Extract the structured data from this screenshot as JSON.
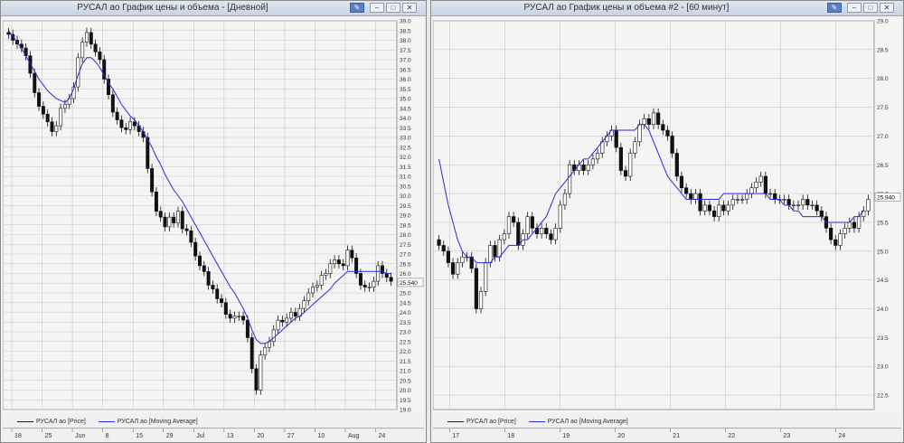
{
  "windows": [
    {
      "title": "РУСАЛ ао График цены и объема - [Дневной]",
      "legend": [
        "РУСАЛ ао [Price]",
        "РУСАЛ ао [Moving Average]"
      ],
      "last_price_label": "25.540",
      "x_labels": [
        "18",
        "25",
        "Jun",
        "8",
        "15",
        "29",
        "Jul",
        "13",
        "20",
        "27",
        "10",
        "Aug",
        "24"
      ],
      "chart_data": {
        "type": "candlestick",
        "ylim": [
          19.0,
          39.0
        ],
        "y_ticks": [
          "39.0",
          "38.5",
          "38.0",
          "37.5",
          "37.0",
          "36.5",
          "36.0",
          "35.5",
          "35.0",
          "34.5",
          "34.0",
          "33.5",
          "33.0",
          "32.5",
          "32.0",
          "31.5",
          "31.0",
          "30.5",
          "30.0",
          "29.5",
          "29.0",
          "28.5",
          "28.0",
          "27.5",
          "27.0",
          "26.5",
          "26.0",
          "25.5",
          "25.0",
          "24.5",
          "24.0",
          "23.5",
          "23.0",
          "22.5",
          "22.0",
          "21.5",
          "21.0",
          "20.5",
          "20.0",
          "19.5",
          "19.0"
        ],
        "close": [
          38.3,
          38.0,
          37.8,
          37.6,
          37.2,
          36.3,
          35.3,
          34.6,
          34.2,
          33.8,
          33.3,
          33.6,
          34.5,
          34.7,
          35.0,
          35.6,
          37.1,
          37.9,
          38.4,
          37.8,
          37.4,
          37.0,
          36.0,
          35.2,
          34.3,
          33.9,
          33.5,
          33.4,
          33.8,
          33.6,
          33.3,
          33.0,
          31.4,
          30.2,
          29.2,
          28.9,
          28.4,
          28.9,
          28.6,
          29.2,
          28.3,
          28.2,
          27.6,
          26.9,
          26.4,
          26.1,
          25.4,
          25.2,
          24.7,
          24.5,
          23.9,
          23.7,
          23.8,
          23.8,
          23.6,
          22.7,
          21.1,
          20.0,
          21.8,
          22.2,
          22.5,
          23.1,
          23.6,
          23.5,
          23.7,
          24.0,
          23.8,
          24.2,
          24.6,
          25.0,
          25.3,
          25.4,
          25.9,
          26.0,
          26.5,
          26.7,
          26.5,
          26.4,
          27.2,
          26.8,
          26.0,
          25.4,
          25.3,
          25.3,
          25.6,
          26.4,
          26.0,
          25.8,
          25.6
        ],
        "ma": [
          38.5,
          38.2,
          37.9,
          37.6,
          37.2,
          36.8,
          36.4,
          36.0,
          35.7,
          35.4,
          35.2,
          35.0,
          34.9,
          34.8,
          35.0,
          35.5,
          36.2,
          36.8,
          37.1,
          37.1,
          36.9,
          36.6,
          36.2,
          35.8,
          35.5,
          35.1,
          34.7,
          34.4,
          34.1,
          33.9,
          33.6,
          33.3,
          32.9,
          32.5,
          32.0,
          31.6,
          31.1,
          30.7,
          30.3,
          30.0,
          29.7,
          29.3,
          28.9,
          28.5,
          28.1,
          27.7,
          27.3,
          26.9,
          26.5,
          26.1,
          25.7,
          25.3,
          25.0,
          24.6,
          24.2,
          23.7,
          23.1,
          22.6,
          22.4,
          22.4,
          22.5,
          22.7,
          22.9,
          23.1,
          23.3,
          23.5,
          23.7,
          23.8,
          24.0,
          24.2,
          24.4,
          24.6,
          24.8,
          25.0,
          25.2,
          25.5,
          25.7,
          25.9,
          26.1,
          26.1,
          26.1,
          26.1,
          26.1,
          26.1,
          26.1,
          26.1,
          26.1,
          26.0,
          26.0
        ]
      }
    },
    {
      "title": "РУСАЛ ао График цены и объема #2 - [60 минут]",
      "legend": [
        "РУСАЛ ао [Price]",
        "РУСАЛ ао [Moving Average]"
      ],
      "last_price_label": "25.940",
      "x_labels": [
        "17",
        "18",
        "19",
        "20",
        "21",
        "22",
        "23",
        "24"
      ],
      "chart_data": {
        "type": "candlestick",
        "ylim": [
          22.25,
          29.0
        ],
        "y_ticks": [
          "29.0",
          "28.5",
          "28.0",
          "27.5",
          "27.0",
          "26.5",
          "26.0",
          "25.5",
          "25.0",
          "24.5",
          "24.0",
          "23.5",
          "23.0",
          "22.5"
        ],
        "close": [
          25.1,
          25.0,
          24.8,
          24.6,
          24.8,
          24.9,
          24.9,
          24.7,
          24.0,
          24.3,
          24.8,
          25.1,
          24.9,
          25.2,
          25.3,
          25.6,
          25.5,
          25.1,
          25.3,
          25.6,
          25.4,
          25.3,
          25.4,
          25.3,
          25.2,
          25.4,
          25.8,
          26.0,
          26.5,
          26.4,
          26.5,
          26.4,
          26.5,
          26.6,
          26.7,
          26.9,
          27.0,
          27.1,
          26.8,
          26.4,
          26.3,
          26.7,
          26.9,
          27.2,
          27.3,
          27.2,
          27.4,
          27.2,
          27.1,
          27.0,
          26.7,
          26.3,
          26.1,
          26.0,
          25.9,
          26.0,
          25.7,
          25.8,
          25.7,
          25.6,
          25.8,
          25.7,
          25.8,
          25.9,
          25.9,
          25.9,
          26.0,
          26.1,
          26.2,
          26.3,
          26.0,
          26.0,
          25.9,
          25.9,
          25.9,
          25.8,
          25.8,
          25.8,
          25.9,
          25.8,
          25.8,
          25.7,
          25.6,
          25.4,
          25.2,
          25.1,
          25.3,
          25.4,
          25.5,
          25.4,
          25.6,
          25.7,
          25.9
        ],
        "ma": [
          26.6,
          26.2,
          25.8,
          25.5,
          25.2,
          25.0,
          24.9,
          24.9,
          24.8,
          24.8,
          24.8,
          24.8,
          24.9,
          24.9,
          25.0,
          25.1,
          25.1,
          25.1,
          25.2,
          25.2,
          25.3,
          25.4,
          25.5,
          25.6,
          25.8,
          26.0,
          26.1,
          26.2,
          26.3,
          26.4,
          26.5,
          26.6,
          26.6,
          26.7,
          26.8,
          26.9,
          27.0,
          27.1,
          27.1,
          27.1,
          27.1,
          27.1,
          27.1,
          27.2,
          27.2,
          27.1,
          26.9,
          26.7,
          26.5,
          26.3,
          26.2,
          26.1,
          26.0,
          25.9,
          25.9,
          25.9,
          25.9,
          25.9,
          25.9,
          25.9,
          25.9,
          26.0,
          26.0,
          26.0,
          26.0,
          26.0,
          26.0,
          26.0,
          26.0,
          26.0,
          26.0,
          25.9,
          25.9,
          25.9,
          25.8,
          25.8,
          25.7,
          25.7,
          25.6,
          25.6,
          25.6,
          25.6,
          25.6,
          25.5,
          25.5,
          25.5,
          25.5,
          25.5,
          25.5,
          25.6,
          25.6,
          25.7
        ]
      }
    }
  ],
  "colors": {
    "price": "#111111",
    "ma": "#2a2ad8",
    "grid": "#c9c9c9",
    "plot_bg": "#f4f4f4",
    "last_price_bg": "#ffffff"
  },
  "titlebar_icons": [
    "pin-icon",
    "minimize-icon",
    "maximize-icon",
    "close-icon"
  ]
}
